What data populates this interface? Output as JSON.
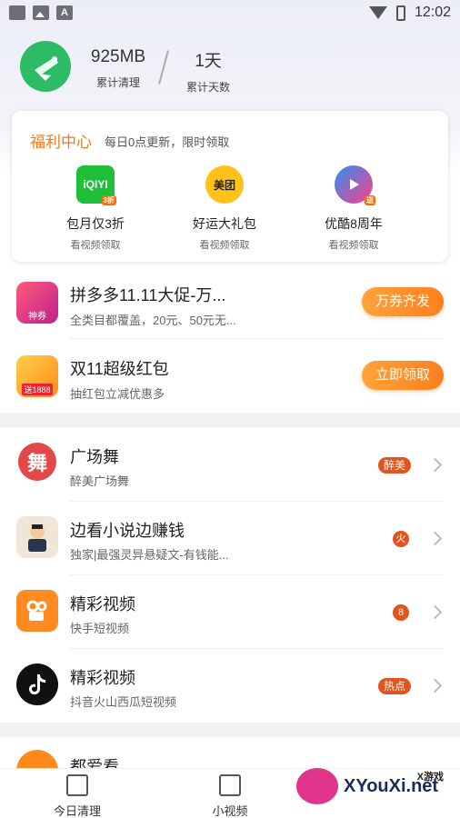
{
  "status_bar": {
    "time": "12:02"
  },
  "header": {
    "cleaned_value": "925MB",
    "cleaned_label": "累计清理",
    "days_value": "1天",
    "days_label": "累计天数"
  },
  "welfare": {
    "title": "福利中心",
    "subtitle": "每日0点更新，限时领取",
    "items": [
      {
        "icon": "iqiyi-icon",
        "logo_text": "iQIYI",
        "badge": "3折",
        "name": "包月仅3折",
        "sub": "看视频领取",
        "color": "#1fbf3a"
      },
      {
        "icon": "meituan-icon",
        "logo_text": "美团",
        "name": "好运大礼包",
        "sub": "看视频领取",
        "color": "#ffc21a"
      },
      {
        "icon": "youku-icon",
        "badge": "送",
        "name": "优酷8周年",
        "sub": "看视频领取",
        "color": "#2e8ff0"
      }
    ]
  },
  "promos": [
    {
      "title": "拼多多11.11大促-万...",
      "sub": "全类目都覆盖，20元、50元无...",
      "button": "万券齐发",
      "icon_text": "神券"
    },
    {
      "title": "双11超级红包",
      "sub": "抽红包立减优惠多",
      "button": "立即领取",
      "icon_text": "送1888"
    }
  ],
  "list": [
    {
      "title": "广场舞",
      "sub": "醉美广场舞",
      "tag": "醉美",
      "icon_glyph": "舞"
    },
    {
      "title": "边看小说边赚钱",
      "sub": "独家|最强灵异悬疑文-有钱能...",
      "tag": "火"
    },
    {
      "title": "精彩视频",
      "sub": "快手短视频",
      "tag": "8"
    },
    {
      "title": "精彩视频",
      "sub": "抖音火山西瓜短视频",
      "tag": "热点"
    },
    {
      "title": "都爱看"
    }
  ],
  "bottom_nav": [
    {
      "label": "今日清理"
    },
    {
      "label": "小视频"
    }
  ],
  "watermark": {
    "text": "XYouXi.net",
    "small": "X游戏"
  }
}
